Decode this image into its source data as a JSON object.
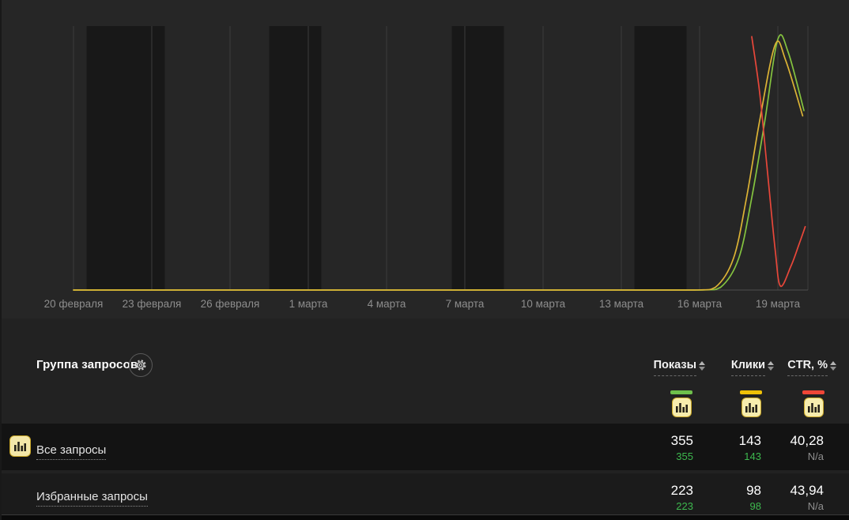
{
  "chart_data": {
    "type": "line",
    "title": "",
    "xlabel": "",
    "ylabel": "",
    "y_axis": "hidden, relative scale 0-100 (no ticks shown in UI)",
    "x_tick_labels": [
      "20 февраля",
      "23 февраля",
      "26 февраля",
      "1 марта",
      "4 марта",
      "7 марта",
      "10 марта",
      "13 марта",
      "16 марта",
      "19 марта"
    ],
    "x_tick_days": [
      0,
      3,
      6,
      9,
      12,
      15,
      18,
      21,
      24,
      27
    ],
    "weekend_bands_days": [
      [
        0.5,
        3.5
      ],
      [
        7.5,
        9.5
      ],
      [
        14.5,
        16.5
      ],
      [
        21.5,
        23.5
      ]
    ],
    "grid": "vertical-only",
    "legend_position": "table-column-toggles-below",
    "series": [
      {
        "key": "impressions",
        "name": "Показы",
        "color": "#84c33f",
        "points": [
          [
            0,
            0
          ],
          [
            5,
            0
          ],
          [
            10,
            0
          ],
          [
            15,
            0
          ],
          [
            20,
            0
          ],
          [
            24,
            0
          ],
          [
            24.8,
            1
          ],
          [
            25.5,
            12
          ],
          [
            26,
            35
          ],
          [
            26.5,
            64
          ],
          [
            27,
            95
          ],
          [
            27.4,
            90
          ],
          [
            28,
            68
          ]
        ]
      },
      {
        "key": "clicks",
        "name": "Клики",
        "color": "#dcb335",
        "points": [
          [
            0,
            0
          ],
          [
            5,
            0
          ],
          [
            10,
            0
          ],
          [
            15,
            0
          ],
          [
            20,
            0
          ],
          [
            23.8,
            0
          ],
          [
            24.6,
            1
          ],
          [
            25.3,
            12
          ],
          [
            25.8,
            35
          ],
          [
            26.3,
            64
          ],
          [
            26.9,
            93
          ],
          [
            27.3,
            87
          ],
          [
            27.95,
            66
          ]
        ]
      },
      {
        "key": "ctr",
        "name": "CTR, %",
        "color": "#e8473a",
        "points": [
          [
            26,
            96
          ],
          [
            26.3,
            75
          ],
          [
            26.6,
            45
          ],
          [
            26.9,
            15
          ],
          [
            27.1,
            1.5
          ],
          [
            27.5,
            9
          ],
          [
            27.8,
            17
          ],
          [
            28.05,
            24
          ]
        ]
      }
    ]
  },
  "table": {
    "group_header": "Группа запросов",
    "columns": [
      {
        "label": "Показы",
        "color": "#6ebf4b"
      },
      {
        "label": "Клики",
        "color": "#efc107"
      },
      {
        "label": "CTR, %",
        "color": "#f04637"
      }
    ],
    "rows": [
      {
        "label": "Все запросы",
        "has_icon": true,
        "values": [
          {
            "main": "355",
            "sub": "355"
          },
          {
            "main": "143",
            "sub": "143"
          },
          {
            "main": "40,28",
            "sub": "N/a"
          }
        ]
      },
      {
        "label": "Избранные запросы",
        "has_icon": false,
        "values": [
          {
            "main": "223",
            "sub": "223"
          },
          {
            "main": "98",
            "sub": "98"
          },
          {
            "main": "43,94",
            "sub": "N/a"
          }
        ]
      }
    ]
  },
  "icons": {
    "settings": "gear-icon",
    "metric_toggle": "bar-chart-icon",
    "sort": "sort-arrows-icon"
  },
  "colors": {
    "page_bg": "#222222",
    "chart_bg": "#262626",
    "weekend_band": "#181818",
    "gridline": "#3c3c3c",
    "axis_line": "#4e4e4e",
    "axis_label": "#8d8d8d",
    "row1_bg": "#131313",
    "row2_bg": "#1b1b1b",
    "green_value": "#3db84e",
    "na_value": "#8f8f8f"
  }
}
